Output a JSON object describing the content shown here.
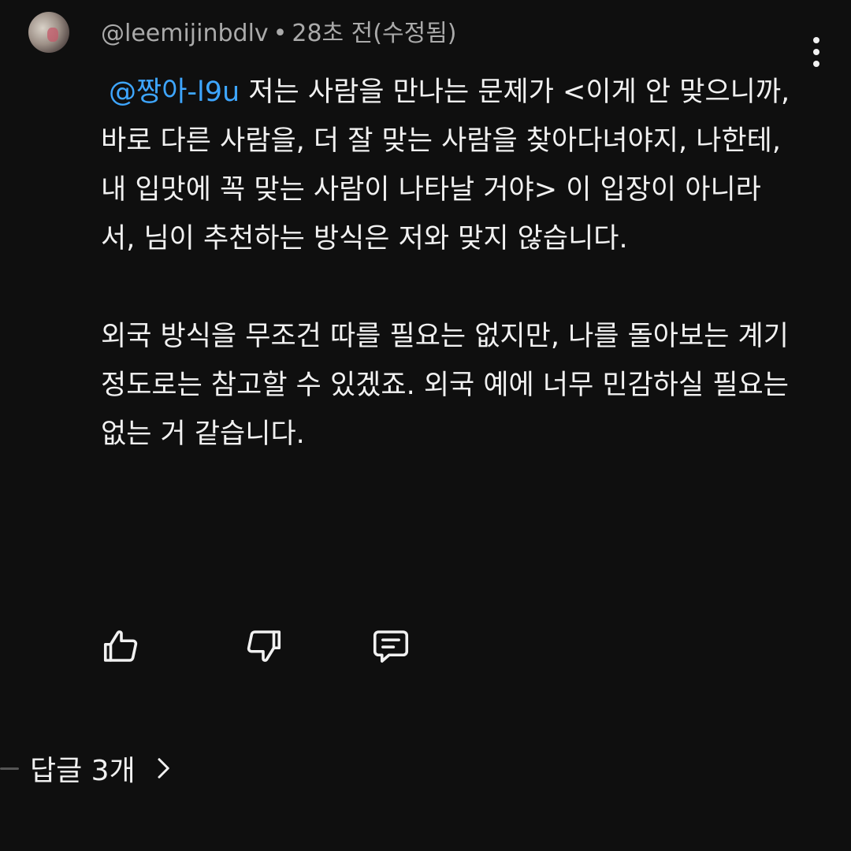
{
  "comment": {
    "author": "@leemijinbdlv",
    "separator": "•",
    "timestamp": "28초 전(수정됨)",
    "mention": "@짱아-l9u",
    "paragraph1": "저는 사람을 만나는 문제가 <이게 안 맞으니까, 바로 다른 사람을, 더 잘 맞는 사람을 찾아다녀야지, 나한테, 내 입맛에 꼭 맞는 사람이 나타날 거야> 이 입장이 아니라서, 님이 추천하는 방식은 저와 맞지 않습니다.",
    "paragraph2": "외국 방식을 무조건 따를 필요는 없지만, 나를 돌아보는 계기 정도로는 참고할 수 있겠죠. 외국 예에 너무 민감하실 필요는 없는 거 같습니다."
  },
  "actions": {
    "icons": [
      "thumbs-up-icon",
      "thumbs-down-icon",
      "reply-comment-icon"
    ]
  },
  "replies": {
    "label": "답글 3개",
    "icon": "chevron-right-icon"
  },
  "colors": {
    "background": "#0f0f0f",
    "text": "#f1f1f1",
    "meta": "#aaaaaa",
    "mention": "#3ea6ff"
  }
}
